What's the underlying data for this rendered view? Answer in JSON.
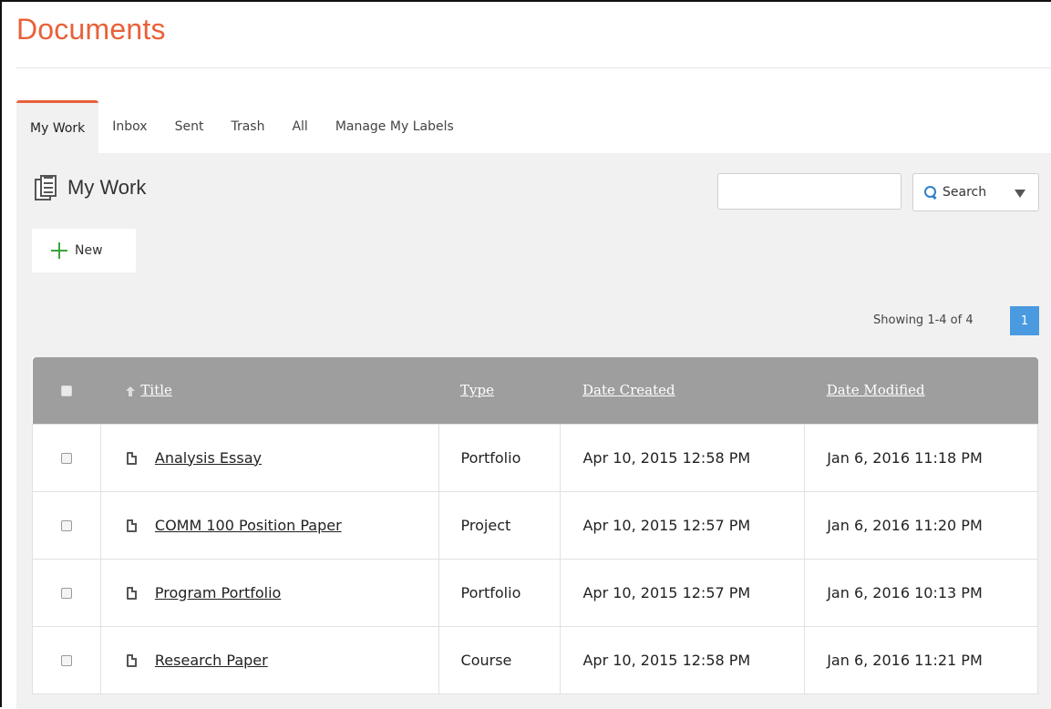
{
  "header": {
    "title": "Documents"
  },
  "tabs": [
    {
      "label": "My Work",
      "active": true
    },
    {
      "label": "Inbox",
      "active": false
    },
    {
      "label": "Sent",
      "active": false
    },
    {
      "label": "Trash",
      "active": false
    },
    {
      "label": "All",
      "active": false
    },
    {
      "label": "Manage My Labels",
      "active": false
    }
  ],
  "section": {
    "title": "My Work",
    "icon": "documents-stack-icon"
  },
  "toolbar": {
    "search_value": "",
    "search_label": "Search",
    "new_label": "New"
  },
  "pagination": {
    "showing": "Showing 1-4 of 4",
    "current_page": "1"
  },
  "table": {
    "columns": [
      "Title",
      "Type",
      "Date Created",
      "Date Modified"
    ],
    "sorted_column": "Title",
    "rows": [
      {
        "title": "Analysis Essay",
        "type": "Portfolio",
        "created": "Apr 10, 2015 12:58 PM",
        "modified": "Jan 6, 2016 11:18 PM"
      },
      {
        "title": "COMM 100 Position Paper",
        "type": "Project",
        "created": "Apr 10, 2015 12:57 PM",
        "modified": "Jan 6, 2016 11:20 PM"
      },
      {
        "title": "Program Portfolio",
        "type": "Portfolio",
        "created": "Apr 10, 2015 12:57 PM",
        "modified": "Jan 6, 2016 10:13 PM"
      },
      {
        "title": "Research Paper",
        "type": "Course",
        "created": "Apr 10, 2015 12:58 PM",
        "modified": "Jan 6, 2016 11:21 PM"
      }
    ]
  },
  "colors": {
    "accent": "#e8613a",
    "header_bg": "#9e9e9e",
    "page_button": "#4a9ae0",
    "plus": "#3ba33b"
  }
}
